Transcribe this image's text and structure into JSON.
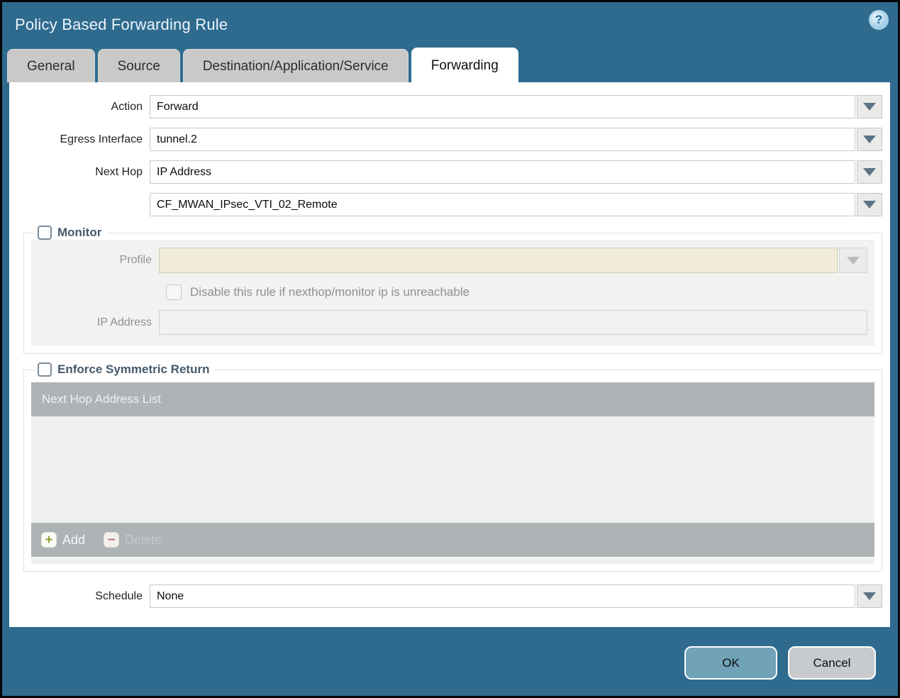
{
  "dialog": {
    "title": "Policy Based Forwarding Rule",
    "help_glyph": "?"
  },
  "tabs": [
    {
      "label": "General",
      "active": false
    },
    {
      "label": "Source",
      "active": false
    },
    {
      "label": "Destination/Application/Service",
      "active": false
    },
    {
      "label": "Forwarding",
      "active": true
    }
  ],
  "form": {
    "action": {
      "label": "Action",
      "value": "Forward"
    },
    "egress_interface": {
      "label": "Egress Interface",
      "value": "tunnel.2"
    },
    "next_hop": {
      "label": "Next Hop",
      "value": "IP Address"
    },
    "next_hop_address": {
      "value": "CF_MWAN_IPsec_VTI_02_Remote"
    },
    "schedule": {
      "label": "Schedule",
      "value": "None"
    }
  },
  "monitor": {
    "legend": "Monitor",
    "checked": false,
    "profile": {
      "label": "Profile",
      "value": ""
    },
    "disable_rule": {
      "label": "Disable this rule if nexthop/monitor ip is unreachable",
      "checked": false
    },
    "ip_address": {
      "label": "IP Address",
      "value": ""
    }
  },
  "symmetric": {
    "legend": "Enforce Symmetric Return",
    "checked": false,
    "table_header": "Next Hop Address List",
    "add_label": "Add",
    "delete_label": "Delete",
    "rows": []
  },
  "footer": {
    "ok_label": "OK",
    "cancel_label": "Cancel"
  },
  "colors": {
    "chrome_teal": "#2e6b8e",
    "ok_button": "#70a3b8",
    "cancel_button": "#c8cbcd",
    "disabled_field_beige": "#f1ecda",
    "table_header_gray": "#aeb3b6",
    "legend_text": "#44596b"
  }
}
